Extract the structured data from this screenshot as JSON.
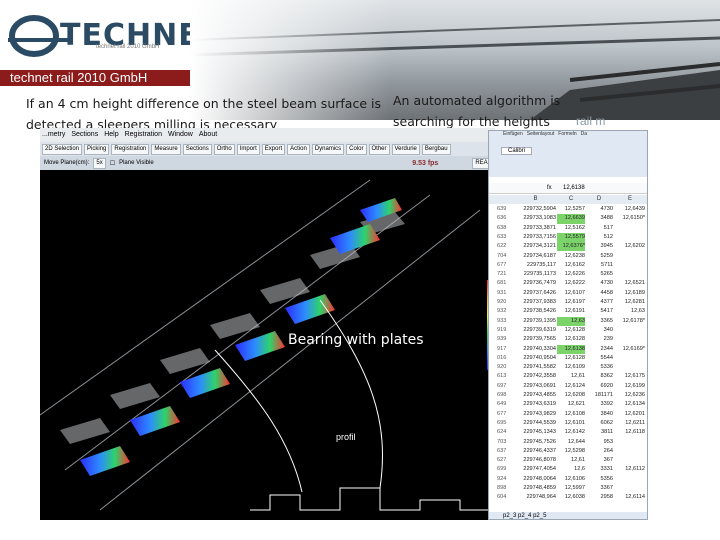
{
  "brand": {
    "logo_text": "TECHNET",
    "logo_subtitle": "technet rail 2010 GmbH",
    "banner": "technet rail 2010 GmbH",
    "photo_overlay": "rail m"
  },
  "captions": {
    "left": "If an 4 cm height difference on the steel beam surface  is detected  a sleepers milling is necessary",
    "right": "An automated algorithm is searching for the heights"
  },
  "app": {
    "menu": [
      "...metry",
      "Sections",
      "Help",
      "Registration",
      "Window",
      "About"
    ],
    "toolbar": [
      "2D Selection",
      "Picking",
      "Registration",
      "Measure",
      "Sections",
      "Ortho",
      "Import",
      "Export",
      "Action",
      "Dynamics",
      "Color",
      "Other",
      "Verdurie",
      "Bergbau"
    ],
    "toolbar2_move": "Move Plane(cm):",
    "toolbar2_move_value": "5x",
    "toolbar2_plane": "Plane Visible",
    "fps": "9.53 fps",
    "read_btn": "READ",
    "overlay_bearing": "Bearing with plates",
    "overlay_profil": "profil"
  },
  "sheet": {
    "ribbon_tabs": [
      "Einfügen",
      "Seitenlayout",
      "Formeln",
      "Da"
    ],
    "font": "Calibri",
    "cell_ref": "fx",
    "fx_value": "12,6138",
    "col_headers": [
      "B",
      "C",
      "D",
      "E"
    ],
    "rows": [
      [
        "639",
        "229732,5904",
        "12,5257",
        "4730",
        "12,6439"
      ],
      [
        "636",
        "229733,1083",
        "12,6639",
        "3488",
        "12,6150*"
      ],
      [
        "638",
        "229733,3871",
        "12,5162",
        "517",
        ""
      ],
      [
        "633",
        "229733,7156",
        "12,5579",
        "512",
        ""
      ],
      [
        "622",
        "229734,3121",
        "12,6376*",
        "3945",
        "12,6202"
      ],
      [
        "704",
        "229734,6187",
        "12,6238",
        "5259",
        ""
      ],
      [
        "677",
        "229735,117",
        "12,6162",
        "5711",
        ""
      ],
      [
        "721",
        "229735,1173",
        "12,6226",
        "5265",
        ""
      ],
      [
        "681",
        "229736,7479",
        "12,6222",
        "4730",
        "12,6521"
      ],
      [
        "931",
        "229737,6426",
        "12,6107",
        "4458",
        "12,6189"
      ],
      [
        "920",
        "229737,9383",
        "12,6197",
        "4377",
        "12,6281"
      ],
      [
        "932",
        "229738,5426",
        "12,6191",
        "5417",
        "12,63"
      ],
      [
        "933",
        "229739,1395",
        "12,63",
        "3365",
        "12,6178*"
      ],
      [
        "919",
        "229739,6319",
        "12,6128",
        "340",
        ""
      ],
      [
        "939",
        "229739,7565",
        "12,6128",
        "239",
        ""
      ],
      [
        "917",
        "229740,3304",
        "12,6138",
        "2344",
        "12,6169*"
      ],
      [
        "016",
        "229740,9504",
        "12,6128",
        "5544",
        ""
      ],
      [
        "920",
        "229741,5582",
        "12,6109",
        "5336",
        ""
      ],
      [
        "613",
        "229742,3558",
        "12,61",
        "8362",
        "12,6175"
      ],
      [
        "697",
        "229743,0691",
        "12,6124",
        "6920",
        "12,6199"
      ],
      [
        "698",
        "229743,4855",
        "12,6208",
        "181171",
        "12,6236"
      ],
      [
        "649",
        "229743,6319",
        "12,621",
        "3392",
        "12,6134"
      ],
      [
        "677",
        "229743,9829",
        "12,6108",
        "3840",
        "12,6201"
      ],
      [
        "695",
        "229744,5539",
        "12,6101",
        "6062",
        "12,6211"
      ],
      [
        "624",
        "229745,1343",
        "12,6142",
        "3811",
        "12,6118"
      ],
      [
        "703",
        "229745,7526",
        "12,644",
        "953",
        ""
      ],
      [
        "637",
        "229746,4337",
        "12,5298",
        "264",
        ""
      ],
      [
        "627",
        "229746,8078",
        "12,61",
        "367",
        ""
      ],
      [
        "699",
        "229747,4054",
        "12,6",
        "3331",
        "12,6112"
      ],
      [
        "924",
        "229748,0064",
        "12,6106",
        "5356",
        ""
      ],
      [
        "898",
        "229748,4859",
        "12,5997",
        "3367",
        ""
      ],
      [
        "604",
        "229748,964",
        "12,6038",
        "2958",
        "12,6114"
      ]
    ],
    "highlight_rows": [
      1,
      3,
      4,
      12,
      15
    ],
    "footer_tabs": [
      "p2_3",
      "p2_4",
      "p2_5"
    ]
  },
  "colors": {
    "banner": "#8c1b1b",
    "brand_blue": "#2a4b63",
    "cell_highlight": "#7bd36a"
  }
}
